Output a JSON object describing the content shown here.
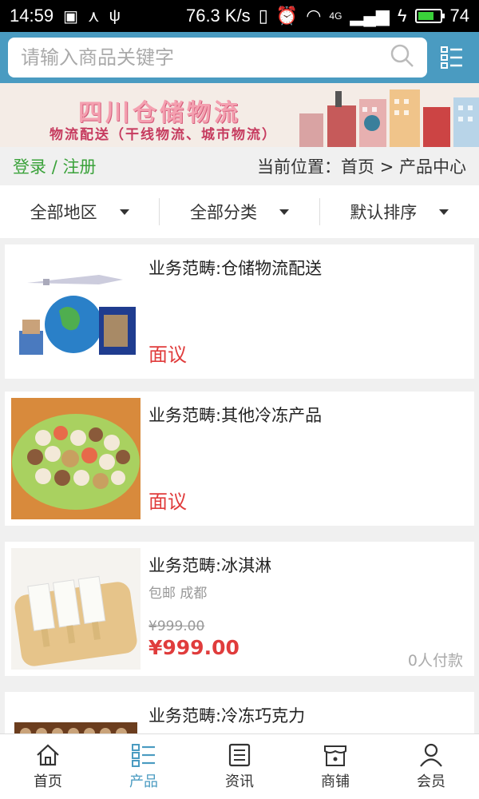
{
  "status": {
    "time": "14:59",
    "speed": "76.3 K/s",
    "battery": "74",
    "network": "4G"
  },
  "search": {
    "placeholder": "请输入商品关键字"
  },
  "banner": {
    "title": "四川仓储物流",
    "subtitle": "物流配送（干线物流、城市物流）"
  },
  "nav": {
    "login": "登录",
    "separator": "/",
    "register": "注册",
    "location": "当前位置：首页 > 产品中心"
  },
  "filters": [
    {
      "label": "全部地区"
    },
    {
      "label": "全部分类"
    },
    {
      "label": "默认排序"
    }
  ],
  "products": [
    {
      "name": "业务范畴:仓储物流配送",
      "price": "面议"
    },
    {
      "name": "业务范畴:其他冷冻产品",
      "price": "面议"
    },
    {
      "name": "业务范畴:冰淇淋",
      "tags": "包邮 成都",
      "old_price": "¥999.00",
      "price": "¥999.00",
      "paid": "0人付款"
    },
    {
      "name": "业务范畴:冷冻巧克力"
    }
  ],
  "tabs": [
    {
      "label": "首页"
    },
    {
      "label": "产品"
    },
    {
      "label": "资讯"
    },
    {
      "label": "商铺"
    },
    {
      "label": "会员"
    }
  ],
  "colors": {
    "accent": "#4a9bc1",
    "price": "#e03c3c",
    "login": "#3aa23a"
  }
}
